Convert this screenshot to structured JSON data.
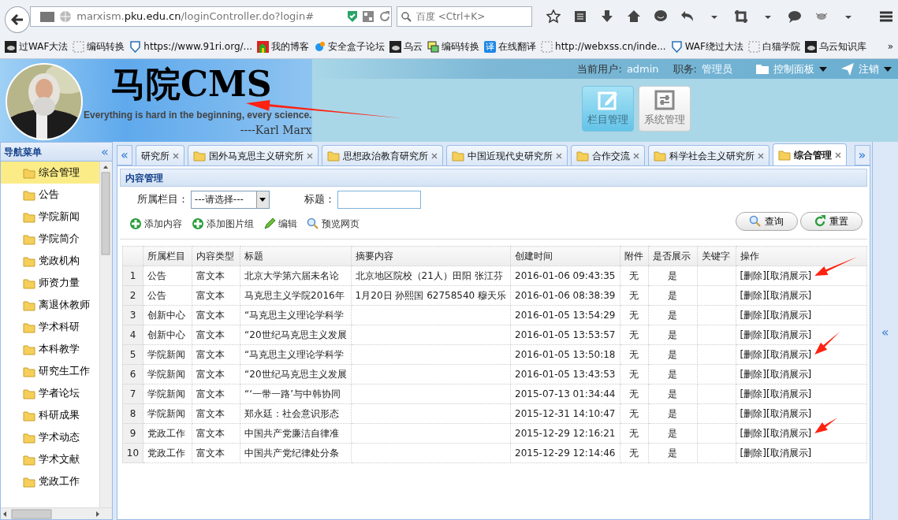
{
  "browser": {
    "url": "marxism.**pku.edu.cn**/loginController.do?login#",
    "search": {
      "placeholder": "百度 <Ctrl+K>"
    },
    "bookmarks": [
      {
        "label": "过WAF大法",
        "kind": "cloud"
      },
      {
        "label": "编码转换",
        "kind": "blank"
      },
      {
        "label": "https://www.91ri.org/...",
        "kind": "shield"
      },
      {
        "label": "我的博客",
        "kind": "castle"
      },
      {
        "label": "安全盒子论坛",
        "kind": "ring"
      },
      {
        "label": "乌云",
        "kind": "cloud"
      },
      {
        "label": "编码转换",
        "kind": "doc"
      },
      {
        "label": "在线翻译",
        "kind": "badge",
        "badge": "译"
      },
      {
        "label": "http://webxss.cn/inde...",
        "kind": "blank"
      },
      {
        "label": "WAF绕过大法",
        "kind": "shield"
      },
      {
        "label": "白猫学院",
        "kind": "blank"
      },
      {
        "label": "乌云知识库",
        "kind": "cloud"
      }
    ],
    "more": "»"
  },
  "header": {
    "title": "马院CMS",
    "motto": "Everything is hard in the beginning, every science.",
    "author": "----Karl Marx",
    "user_label": "当前用户:",
    "user": "admin",
    "role_label": "职务:",
    "role": "管理员",
    "menus": [
      {
        "label": "控制面板",
        "kind": "panel"
      },
      {
        "label": "注销",
        "kind": "logout"
      }
    ],
    "modules": [
      {
        "label": "栏目管理",
        "kind": "edit",
        "selected": true
      },
      {
        "label": "系统管理",
        "kind": "sliders",
        "selected": false
      }
    ]
  },
  "sidebar": {
    "title": "导航菜单",
    "collapse": "«",
    "items": [
      {
        "label": "综合管理",
        "selected": true
      },
      {
        "label": "公告",
        "selected": false
      },
      {
        "label": "学院新闻",
        "selected": false
      },
      {
        "label": "学院简介",
        "selected": false
      },
      {
        "label": "党政机构",
        "selected": false
      },
      {
        "label": "师资力量",
        "selected": false
      },
      {
        "label": "离退休教师",
        "selected": false
      },
      {
        "label": "学术科研",
        "selected": false
      },
      {
        "label": "本科教学",
        "selected": false
      },
      {
        "label": "研究生工作",
        "selected": false
      },
      {
        "label": "学者论坛",
        "selected": false
      },
      {
        "label": "科研成果",
        "selected": false
      },
      {
        "label": "学术动态",
        "selected": false
      },
      {
        "label": "学术文献",
        "selected": false
      },
      {
        "label": "党政工作",
        "selected": false
      }
    ]
  },
  "tabs": {
    "prev": "«",
    "next": "»",
    "items": [
      {
        "label": "研究所",
        "selected": false,
        "icon": false
      },
      {
        "label": "国外马克思主义研究所",
        "selected": false,
        "icon": true
      },
      {
        "label": "思想政治教育研究所",
        "selected": false,
        "icon": true
      },
      {
        "label": "中国近现代史研究所",
        "selected": false,
        "icon": true
      },
      {
        "label": "合作交流",
        "selected": false,
        "icon": true
      },
      {
        "label": "科学社会主义研究所",
        "selected": false,
        "icon": true
      },
      {
        "label": "综合管理",
        "selected": true,
        "icon": true
      }
    ]
  },
  "right_collapse": "«",
  "panel": {
    "title": "内容管理",
    "filters": [
      {
        "label": "所属栏目：",
        "kind": "select",
        "value": "---请选择---"
      },
      {
        "label": "标题：",
        "kind": "text"
      }
    ],
    "actions": [
      {
        "label": "添加内容",
        "kind": "add"
      },
      {
        "label": "添加图片组",
        "kind": "add"
      },
      {
        "label": "编辑",
        "kind": "edit"
      },
      {
        "label": "预览网页",
        "kind": "search"
      }
    ],
    "buttons": [
      {
        "label": "查询",
        "kind": "search"
      },
      {
        "label": "重置",
        "kind": "reset"
      }
    ],
    "table": {
      "columns": [
        "所属栏目",
        "内容类型",
        "标题",
        "摘要内容",
        "创建时间",
        "附件",
        "是否展示",
        "关键字",
        "操作"
      ],
      "rows": [
        {
          "no": "1",
          "section": "公告",
          "type": "富文本",
          "title": "北京大学第六届未名论",
          "summary": "北京地区院校（21人）田阳 张江芬",
          "created": "2016-01-06 09:43:35",
          "attachment": "无",
          "shown": "是",
          "ops": [
            "[删除]",
            "[取消展示]"
          ]
        },
        {
          "no": "2",
          "section": "公告",
          "type": "富文本",
          "title": "马克思主义学院2016年",
          "summary": "1月20日 孙熙国 62758540 穆天乐",
          "created": "2016-01-06 08:38:39",
          "attachment": "无",
          "shown": "是",
          "ops": [
            "[删除]",
            "[取消展示]"
          ]
        },
        {
          "no": "3",
          "section": "创新中心",
          "type": "富文本",
          "title": "“马克思主义理论学科学",
          "created": "2016-01-05 13:54:29",
          "attachment": "无",
          "shown": "是",
          "ops": [
            "[删除]",
            "[取消展示]"
          ]
        },
        {
          "no": "4",
          "section": "创新中心",
          "type": "富文本",
          "title": "“20世纪马克思主义发展",
          "created": "2016-01-05 13:53:57",
          "attachment": "无",
          "shown": "是",
          "ops": [
            "[删除]",
            "[取消展示]"
          ]
        },
        {
          "no": "5",
          "section": "学院新闻",
          "type": "富文本",
          "title": "“马克思主义理论学科学",
          "created": "2016-01-05 13:50:18",
          "attachment": "无",
          "shown": "是",
          "ops": [
            "[删除]",
            "[取消展示]"
          ]
        },
        {
          "no": "6",
          "section": "学院新闻",
          "type": "富文本",
          "title": "“20世纪马克思主义发展",
          "created": "2016-01-05 13:43:53",
          "attachment": "无",
          "shown": "是",
          "ops": [
            "[删除]",
            "[取消展示]"
          ]
        },
        {
          "no": "7",
          "section": "学院新闻",
          "type": "富文本",
          "title": "“‘一带一路’与中韩协同",
          "created": "2015-07-13 01:34:44",
          "attachment": "无",
          "shown": "是",
          "ops": [
            "[删除]",
            "[取消展示]"
          ]
        },
        {
          "no": "8",
          "section": "学院新闻",
          "type": "富文本",
          "title": "郑永廷：社会意识形态",
          "created": "2015-12-31 14:10:47",
          "attachment": "无",
          "shown": "是",
          "ops": [
            "[删除]",
            "[取消展示]"
          ]
        },
        {
          "no": "9",
          "section": "党政工作",
          "type": "富文本",
          "title": "中国共产党廉洁自律准",
          "created": "2015-12-29 12:16:21",
          "attachment": "无",
          "shown": "是",
          "ops": [
            "[删除]",
            "[取消展示]"
          ]
        },
        {
          "no": "10",
          "section": "党政工作",
          "type": "富文本",
          "title": "中国共产党纪律处分条",
          "created": "2015-12-29 12:14:46",
          "attachment": "无",
          "shown": "是",
          "ops": [
            "[删除]",
            "[取消展示]"
          ]
        }
      ]
    }
  },
  "annotations": [
    {
      "kind": "arrow"
    },
    {
      "kind": "arrow"
    },
    {
      "kind": "arrow"
    },
    {
      "kind": "arrow"
    }
  ]
}
